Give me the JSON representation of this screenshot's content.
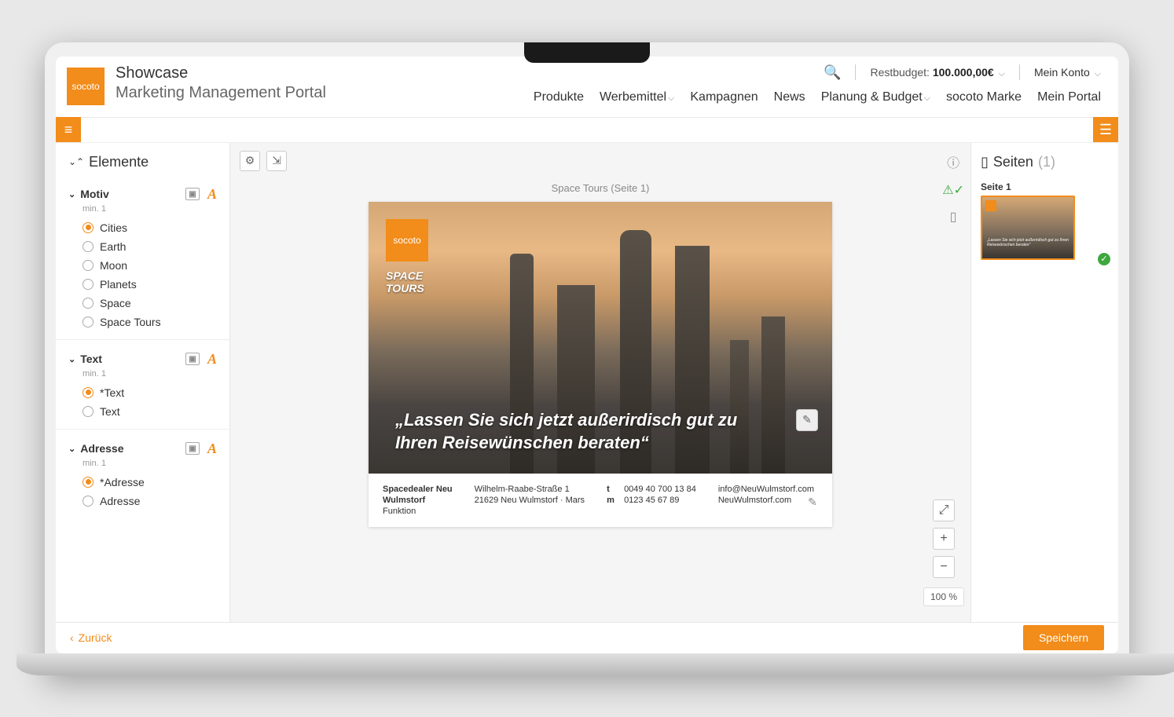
{
  "brand": "socoto",
  "header": {
    "title": "Showcase",
    "subtitle": "Marketing Management Portal",
    "budget_label": "Restbudget:",
    "budget_value": "100.000,00€",
    "account_label": "Mein Konto",
    "nav": [
      "Produkte",
      "Werbemittel",
      "Kampagnen",
      "News",
      "Planung & Budget",
      "socoto Marke",
      "Mein Portal"
    ],
    "nav_has_dropdown": [
      false,
      true,
      false,
      false,
      true,
      false,
      false
    ]
  },
  "sidebar_left": {
    "title": "Elemente",
    "sections": [
      {
        "label": "Motiv",
        "min_label": "min. 1",
        "items": [
          "Cities",
          "Earth",
          "Moon",
          "Planets",
          "Space",
          "Space Tours"
        ],
        "selected": 0
      },
      {
        "label": "Text",
        "min_label": "min. 1",
        "items": [
          "*Text",
          "Text"
        ],
        "selected": 0
      },
      {
        "label": "Adresse",
        "min_label": "min. 1",
        "items": [
          "*Adresse",
          "Adresse"
        ],
        "selected": 0
      }
    ]
  },
  "canvas": {
    "page_label": "Space Tours (Seite 1)",
    "logo_text": "socoto",
    "brand_line1": "SPACE",
    "brand_line2": "TOURS",
    "slogan": "„Lassen Sie sich jetzt außerirdisch gut zu Ihren Reisewünschen beraten“",
    "footer": {
      "dealer_line1": "Spacedealer Neu",
      "dealer_line2": "Wulmstorf",
      "dealer_line3": "Funktion",
      "street": "Wilhelm-Raabe-Straße 1",
      "city": "21629 Neu Wulmstorf · Mars",
      "phone_t": "0049 40 700 13 84",
      "phone_m": "0123 45 67 89",
      "email": "info@NeuWulmstorf.com",
      "web": "NeuWulmstorf.com"
    },
    "zoom": "100 %"
  },
  "sidebar_right": {
    "title": "Seiten",
    "count": "(1)",
    "page1_label": "Seite 1"
  },
  "footer_bar": {
    "back": "Zurück",
    "save": "Speichern"
  }
}
